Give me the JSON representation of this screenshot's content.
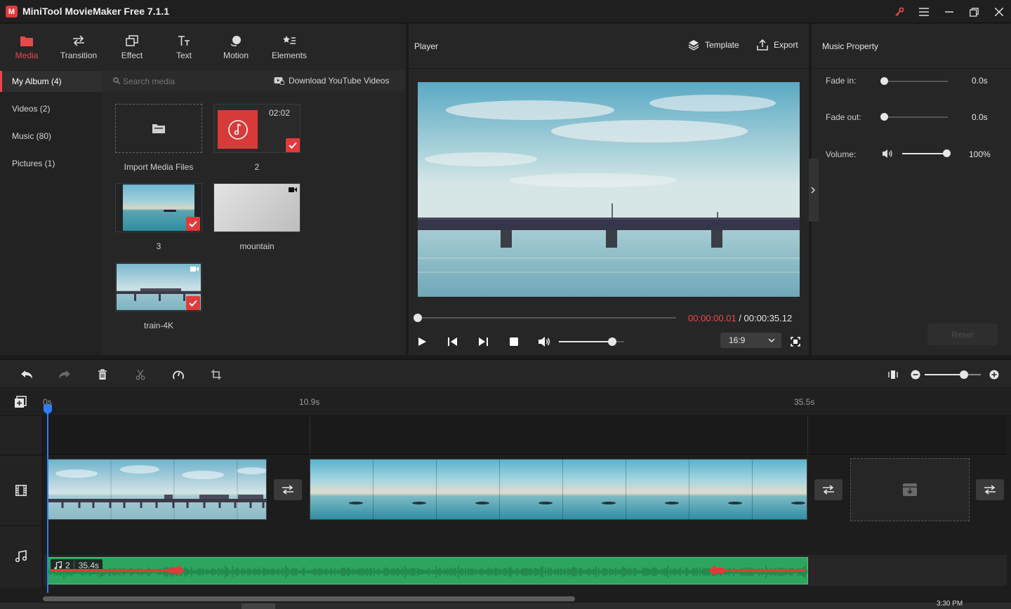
{
  "app": {
    "title": "MiniTool MovieMaker Free 7.1.1"
  },
  "colors": {
    "accent": "#e84a4a",
    "playhead": "#2a7fff",
    "audio": "#2ea55e",
    "time_current": "#e84a4a"
  },
  "toolbar_tabs": [
    {
      "label": "Media",
      "icon": "folder-icon",
      "active": true
    },
    {
      "label": "Transition",
      "icon": "swap-arrows-icon"
    },
    {
      "label": "Effect",
      "icon": "effect-icon"
    },
    {
      "label": "Text",
      "icon": "text-icon"
    },
    {
      "label": "Motion",
      "icon": "motion-icon"
    },
    {
      "label": "Elements",
      "icon": "elements-icon"
    }
  ],
  "sidebar": {
    "items": [
      {
        "label": "My Album (4)",
        "active": true
      },
      {
        "label": "Videos (2)"
      },
      {
        "label": "Music (80)"
      },
      {
        "label": "Pictures (1)"
      }
    ]
  },
  "media": {
    "search_placeholder": "Search media",
    "download_label": "Download YouTube Videos",
    "import_label": "Import Media Files",
    "items": [
      {
        "name": "2",
        "duration": "02:02",
        "type": "music",
        "checked": true
      },
      {
        "name": "3",
        "type": "image",
        "checked": true
      },
      {
        "name": "mountain",
        "type": "video",
        "checked": false
      },
      {
        "name": "train-4K",
        "type": "video",
        "checked": true
      }
    ]
  },
  "player": {
    "title": "Player",
    "template_label": "Template",
    "export_label": "Export",
    "current_time": "00:00:00.01",
    "separator": " / ",
    "total_time": "00:00:35.12",
    "aspect_ratio": "16:9",
    "volume_level": 0.82,
    "progress": 0.0
  },
  "music_property": {
    "title": "Music Property",
    "fade_in_label": "Fade in:",
    "fade_in_value": "0.0s",
    "fade_out_label": "Fade out:",
    "fade_out_value": "0.0s",
    "volume_label": "Volume:",
    "volume_value": "100%",
    "volume_level": 1.0,
    "reset_label": "Reset"
  },
  "timeline": {
    "ruler": [
      "0s",
      "10.9s",
      "35.5s"
    ],
    "audio_clip": {
      "name": "2",
      "duration": "35.4s"
    },
    "zoom_level": 0.7
  },
  "taskbar": {
    "time": "3:30 PM"
  }
}
